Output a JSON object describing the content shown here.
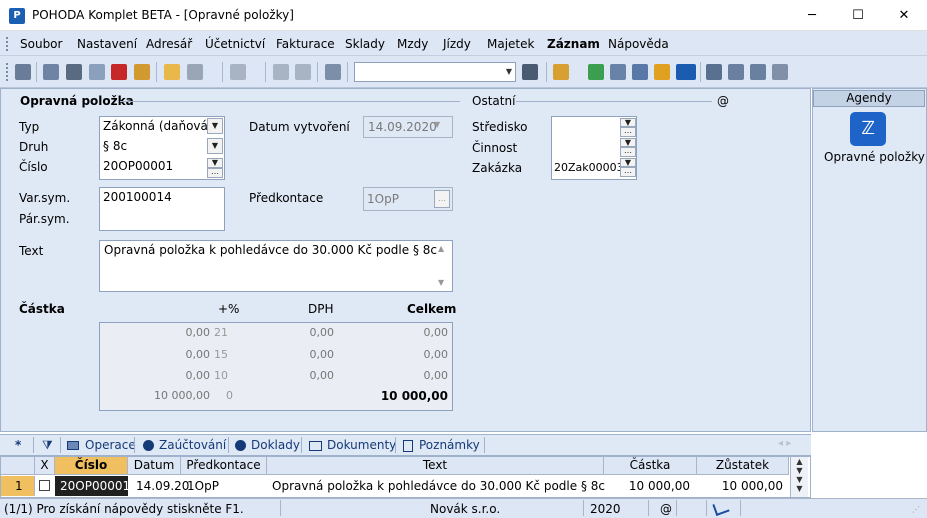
{
  "window": {
    "title": "POHODA Komplet BETA - [Opravné položky]",
    "app_icon": "pohoda-icon",
    "controls": {
      "minimize": "─",
      "maximize": "☐",
      "close": "✕"
    }
  },
  "menu": [
    "Soubor",
    "Nastavení",
    "Adresář",
    "Účetnictví",
    "Fakturace",
    "Sklady",
    "Mzdy",
    "Jízdy",
    "Majetek",
    "Záznam",
    "Nápověda"
  ],
  "toolbar": {
    "combo_value": ""
  },
  "form": {
    "section_title": "Opravná položka",
    "typ": {
      "label": "Typ",
      "value": "Zákonná (daňová)"
    },
    "druh": {
      "label": "Druh",
      "value": "§ 8c"
    },
    "cislo": {
      "label": "Číslo",
      "value": "20OP00001"
    },
    "datum": {
      "label": "Datum vytvoření",
      "value": "14.09.2020"
    },
    "varsym": {
      "label": "Var.sym.",
      "value": "200100014"
    },
    "parsym": {
      "label": "Pár.sym.",
      "value": ""
    },
    "predkontace": {
      "label": "Předkontace",
      "value": "1OpP"
    },
    "text": {
      "label": "Text",
      "value": "Opravná položka k pohledávce do 30.000 Kč podle § 8c"
    },
    "ostatni": {
      "title": "Ostatní",
      "at": "@",
      "stredisko": {
        "label": "Středisko",
        "value": ""
      },
      "cinnost": {
        "label": "Činnost",
        "value": ""
      },
      "zakazka": {
        "label": "Zakázka",
        "value": "20Zak00003"
      }
    },
    "amounts": {
      "headers": {
        "castka": "Částka",
        "pct": "+%",
        "dph": "DPH",
        "celkem": "Celkem"
      },
      "rows": [
        {
          "base": "0,00",
          "pct": "21",
          "dph": "0,00",
          "total": "0,00"
        },
        {
          "base": "0,00",
          "pct": "15",
          "dph": "0,00",
          "total": "0,00"
        },
        {
          "base": "0,00",
          "pct": "10",
          "dph": "0,00",
          "total": "0,00"
        },
        {
          "base": "10 000,00",
          "pct": "0",
          "dph": "",
          "total": "10 000,00"
        }
      ]
    }
  },
  "side": {
    "header": "Agendy",
    "icon": "opravne-polozky-icon",
    "icon_glyph": "ℤ",
    "label": "Opravné položky"
  },
  "tabs": {
    "star": "*",
    "filter": "⧩",
    "items": [
      "Operace",
      "Zaúčtování",
      "Doklady",
      "Dokumenty",
      "Poznámky"
    ],
    "nav": "◂ ▸"
  },
  "grid": {
    "headers": [
      "X",
      "Číslo",
      "Datum",
      "Předkontace",
      "Text",
      "Částka",
      "Zůstatek"
    ],
    "rows": [
      {
        "num": "1",
        "x": "",
        "cislo": "20OP00001",
        "datum": "14.09.20",
        "predkontace": "1OpP",
        "text": "Opravná položka k pohledávce do 30.000 Kč podle § 8c",
        "castka": "10 000,00",
        "zustatek": "10 000,00"
      }
    ]
  },
  "status": {
    "help": "(1/1) Pro získání nápovědy stiskněte F1.",
    "company": "Novák s.r.o.",
    "year": "2020",
    "at": "@"
  }
}
